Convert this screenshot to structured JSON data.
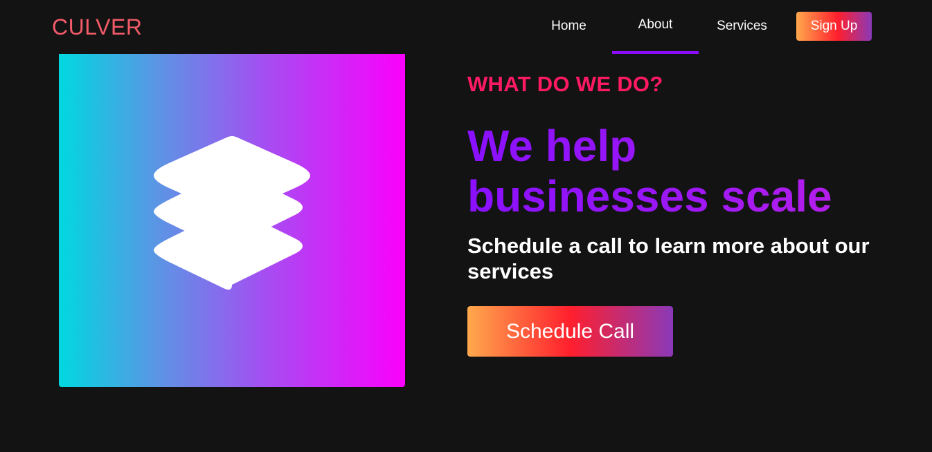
{
  "brand": {
    "logo_text": "CULVER",
    "logo_color": "#f45b69"
  },
  "nav": {
    "links": [
      {
        "label": "Home",
        "active": false
      },
      {
        "label": "About",
        "active": true
      },
      {
        "label": "Services",
        "active": false
      }
    ],
    "signup_label": "Sign Up",
    "active_underline_color": "#8d0bfb"
  },
  "hero": {
    "icon": "layers-icon",
    "gradient_colors": [
      "#00d8e0",
      "#a64df2",
      "#fb00fc"
    ]
  },
  "content": {
    "eyebrow": "WHAT DO WE DO?",
    "eyebrow_color": "#ff1a63",
    "headline_line1": "We help",
    "headline_line2": "businesses scale",
    "headline_color": "#8f0ffb",
    "subhead": "Schedule a call to learn more about our services",
    "cta_label": "Schedule Call",
    "button_gradient": [
      "#ffa94d",
      "#ff1f2d",
      "#8a39b8"
    ]
  },
  "page": {
    "background": "#131313"
  }
}
